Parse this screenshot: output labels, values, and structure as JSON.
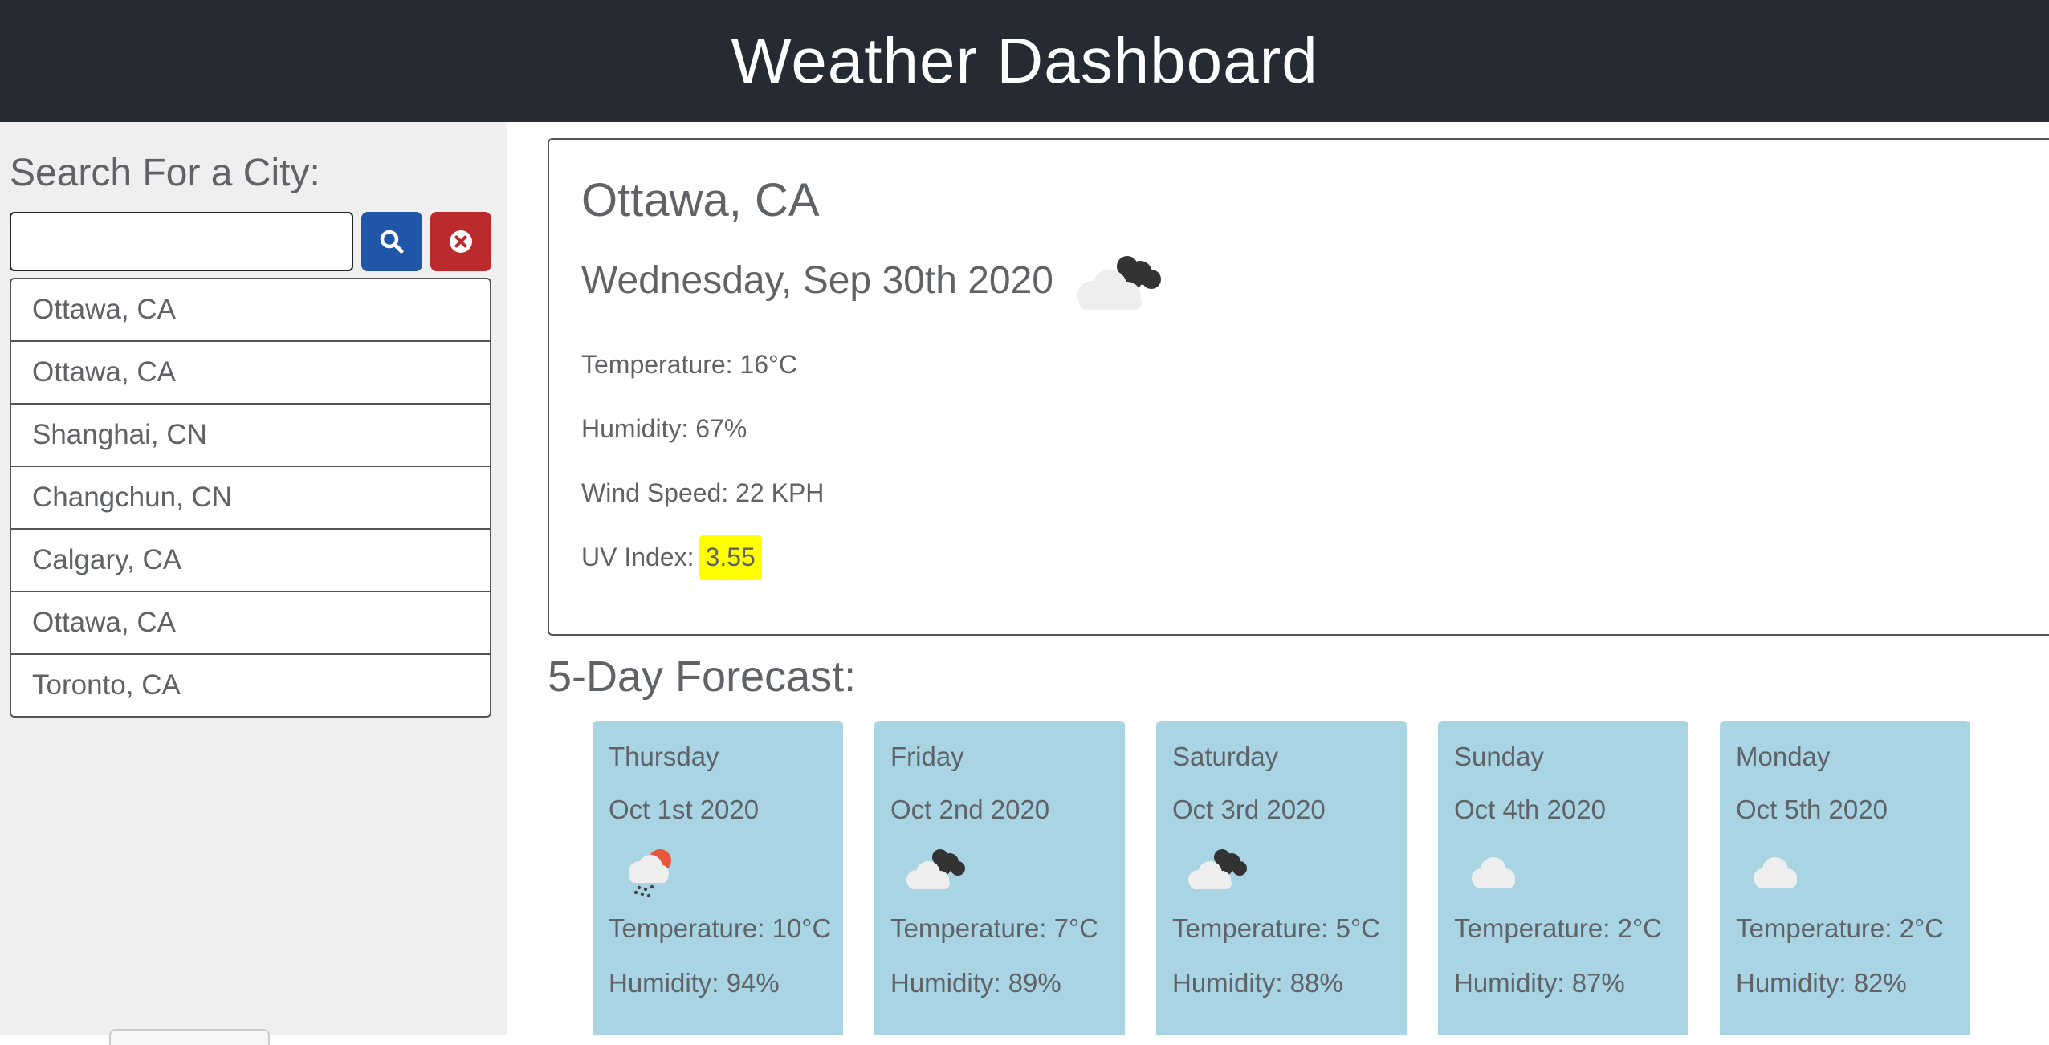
{
  "header": {
    "title": "Weather Dashboard"
  },
  "sidebar": {
    "search_label": "Search For a City:",
    "search_input": {
      "value": "",
      "placeholder": ""
    },
    "search_button_icon": "search-icon",
    "clear_button_icon": "clear-icon",
    "cities": [
      "Ottawa, CA",
      "Ottawa, CA",
      "Shanghai, CN",
      "Changchun, CN",
      "Calgary, CA",
      "Ottawa, CA",
      "Toronto, CA"
    ]
  },
  "current": {
    "city": "Ottawa, CA",
    "date": "Wednesday, Sep 30th 2020",
    "icon": "broken-clouds-icon",
    "temperature": "Temperature: 16°C",
    "humidity": "Humidity: 67%",
    "wind": "Wind Speed: 22 KPH",
    "uv_label": "UV Index:",
    "uv_value": "3.55"
  },
  "forecast": {
    "title": "5-Day Forecast:",
    "days": [
      {
        "day": "Thursday",
        "date": "Oct 1st 2020",
        "icon": "snow-icon",
        "temp": "Temperature: 10°C",
        "humidity": "Humidity: 94%"
      },
      {
        "day": "Friday",
        "date": "Oct 2nd 2020",
        "icon": "broken-clouds-icon",
        "temp": "Temperature: 7°C",
        "humidity": "Humidity: 89%"
      },
      {
        "day": "Saturday",
        "date": "Oct 3rd 2020",
        "icon": "broken-clouds-icon",
        "temp": "Temperature: 5°C",
        "humidity": "Humidity: 88%"
      },
      {
        "day": "Sunday",
        "date": "Oct 4th 2020",
        "icon": "cloud-icon",
        "temp": "Temperature: 2°C",
        "humidity": "Humidity: 87%"
      },
      {
        "day": "Monday",
        "date": "Oct 5th 2020",
        "icon": "cloud-icon",
        "temp": "Temperature: 2°C",
        "humidity": "Humidity: 82%"
      }
    ]
  },
  "colors": {
    "header_bg": "#252a33",
    "search_button": "#1f56a8",
    "clear_button": "#bb2b2c",
    "forecast_card": "#a8d4e4",
    "uv_badge": "#ffff00"
  }
}
